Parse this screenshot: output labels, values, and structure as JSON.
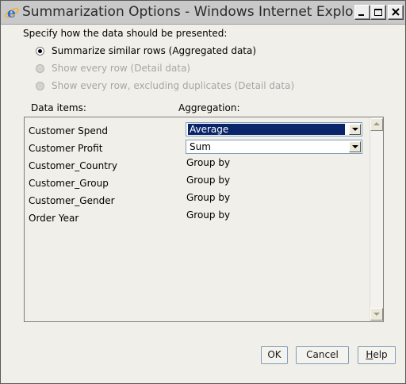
{
  "window": {
    "title": "Summarization Options - Windows Internet Explo...",
    "controls": {
      "minimize": "minimize",
      "maximize": "maximize",
      "close": "close"
    }
  },
  "presentation": {
    "prompt": "Specify how the data should be presented:",
    "options": [
      {
        "label": "Summarize similar rows (Aggregated data)",
        "checked": true,
        "enabled": true
      },
      {
        "label": "Show every row (Detail data)",
        "checked": false,
        "enabled": false
      },
      {
        "label": "Show every row, excluding duplicates (Detail data)",
        "checked": false,
        "enabled": false
      }
    ]
  },
  "columns": {
    "data_items": "Data items:",
    "aggregation": "Aggregation:"
  },
  "rows": [
    {
      "item": "Customer Spend",
      "aggregation": "Average",
      "type": "select"
    },
    {
      "item": "Customer Profit",
      "aggregation": "Sum",
      "type": "select"
    },
    {
      "item": "Customer_Country",
      "aggregation": "Group by",
      "type": "text"
    },
    {
      "item": "Customer_Group",
      "aggregation": "Group by",
      "type": "text"
    },
    {
      "item": "Customer_Gender",
      "aggregation": "Group by",
      "type": "text"
    },
    {
      "item": "Order Year",
      "aggregation": "Group by",
      "type": "text"
    }
  ],
  "buttons": {
    "ok": "OK",
    "cancel": "Cancel",
    "help_first": "H",
    "help_rest": "elp"
  },
  "colors": {
    "selection": "#0a246a",
    "titlebar": "#c9c9c9",
    "dialog_bg": "#f0efe9"
  },
  "icons": {
    "app": "internet-explorer-icon"
  }
}
